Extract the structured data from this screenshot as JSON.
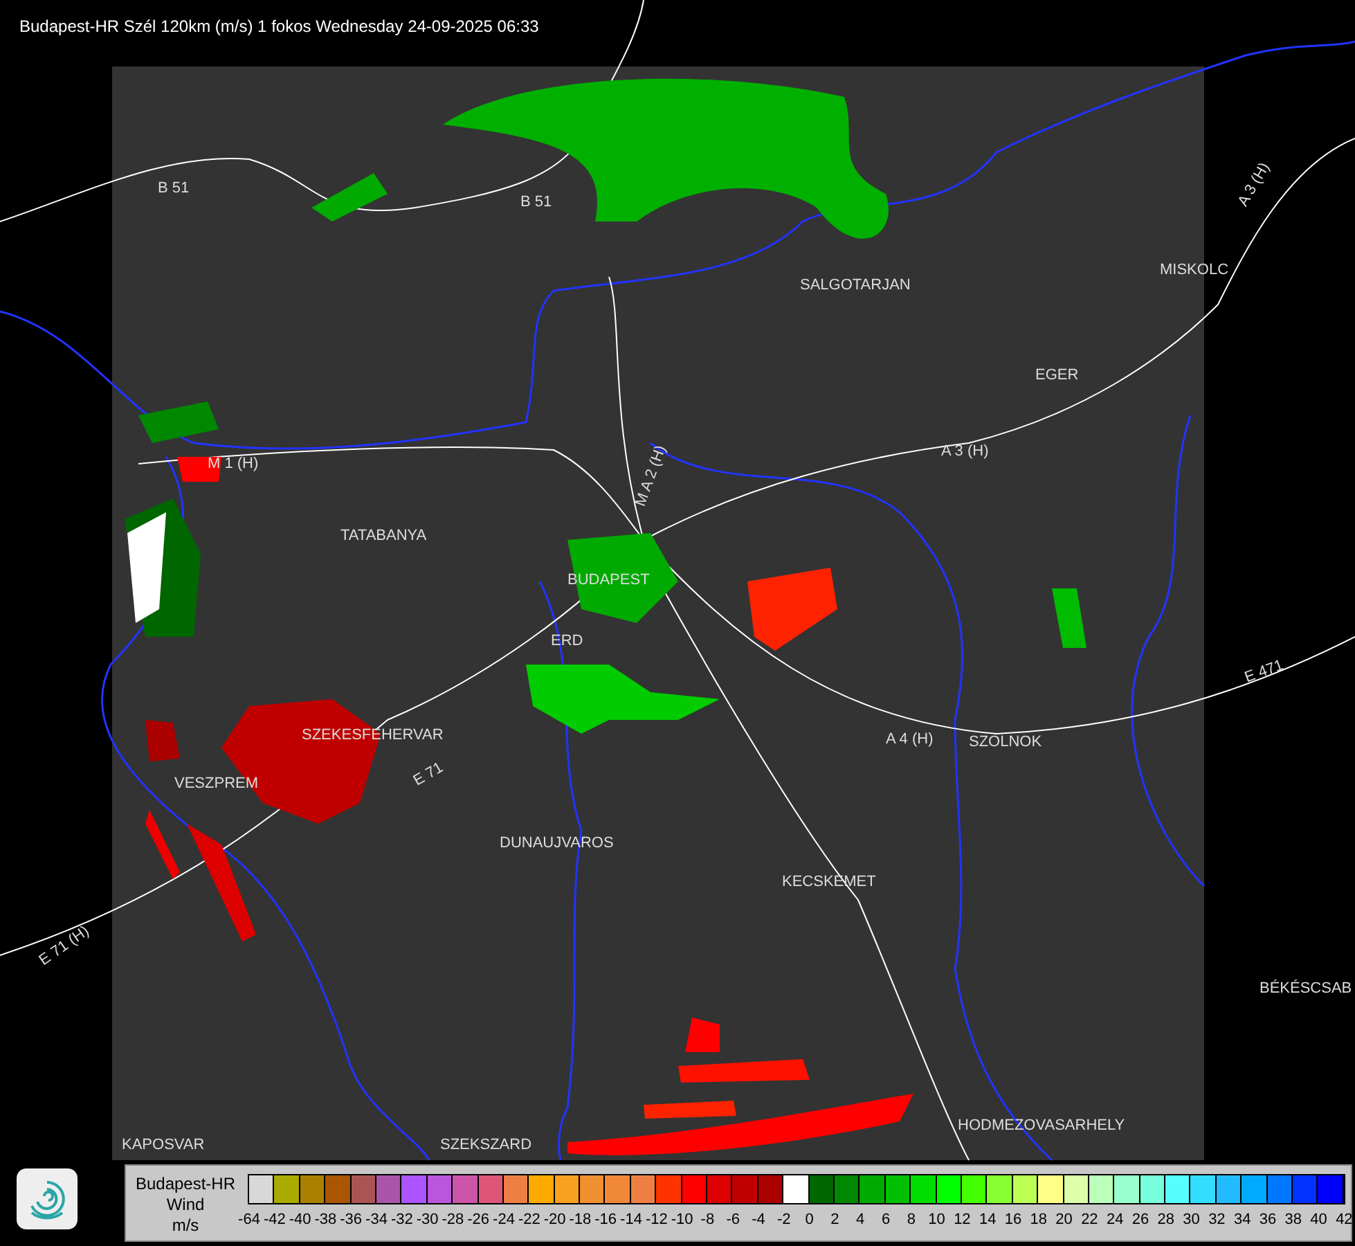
{
  "title": "Budapest-HR Szél 120km (m/s) 1 fokos Wednesday 24-09-2025 06:33",
  "map_labels": [
    {
      "text": "B 51"
    },
    {
      "text": "B 51"
    },
    {
      "text": "SALGOTARJAN"
    },
    {
      "text": "MISKOLC"
    },
    {
      "text": "A 3 (H)"
    },
    {
      "text": "EGER"
    },
    {
      "text": "M 1 (H)"
    },
    {
      "text": "A 3 (H)"
    },
    {
      "text": "M A 2 (H)"
    },
    {
      "text": "TATABANYA"
    },
    {
      "text": "BUDAPEST"
    },
    {
      "text": "ERD"
    },
    {
      "text": "E 471"
    },
    {
      "text": "SZEKESFEHERVAR"
    },
    {
      "text": "E 71"
    },
    {
      "text": "A 4 (H)"
    },
    {
      "text": "SZOLNOK"
    },
    {
      "text": "VESZPREM"
    },
    {
      "text": "DUNAUJVAROS"
    },
    {
      "text": "KECSKEMET"
    },
    {
      "text": "E 71 (H)"
    },
    {
      "text": "BÉKÉSCSAB"
    },
    {
      "text": "HODMEZOVASARHELY"
    },
    {
      "text": "KAPOSVAR"
    },
    {
      "text": "SZEKSZARD"
    }
  ],
  "legend": {
    "title": "Budapest-HR",
    "quantity": "Wind",
    "unit": "m/s",
    "swatches": [
      {
        "color": "#d8d8d8"
      },
      {
        "color": "#aaaa00"
      },
      {
        "color": "#aa8000"
      },
      {
        "color": "#aa5500"
      },
      {
        "color": "#aa5555"
      },
      {
        "color": "#aa55aa"
      },
      {
        "color": "#aa55ff"
      },
      {
        "color": "#bb55dd"
      },
      {
        "color": "#cc55aa"
      },
      {
        "color": "#dd5577"
      },
      {
        "color": "#ee7f44"
      },
      {
        "color": "#ffaa00"
      },
      {
        "color": "#f8a020"
      },
      {
        "color": "#f09030"
      },
      {
        "color": "#f08838"
      },
      {
        "color": "#ee7f44"
      },
      {
        "color": "#ff3300"
      },
      {
        "color": "#ff0000"
      },
      {
        "color": "#dd0000"
      },
      {
        "color": "#c00000"
      },
      {
        "color": "#aa0000"
      },
      {
        "color": "#ffffff"
      },
      {
        "color": "#006600"
      },
      {
        "color": "#008800"
      },
      {
        "color": "#00aa00"
      },
      {
        "color": "#00c000"
      },
      {
        "color": "#00dd00"
      },
      {
        "color": "#00ff00"
      },
      {
        "color": "#44ff00"
      },
      {
        "color": "#88ff33"
      },
      {
        "color": "#bbff55"
      },
      {
        "color": "#ffff88"
      },
      {
        "color": "#ddffaa"
      },
      {
        "color": "#bbffbb"
      },
      {
        "color": "#99ffcc"
      },
      {
        "color": "#77ffdd"
      },
      {
        "color": "#55ffff"
      },
      {
        "color": "#33ddff"
      },
      {
        "color": "#22bbff"
      },
      {
        "color": "#00aaff"
      },
      {
        "color": "#0077ff"
      },
      {
        "color": "#0033ff"
      },
      {
        "color": "#0000ff"
      }
    ],
    "ticks": [
      "-64",
      "-42",
      "-40",
      "-38",
      "-36",
      "-34",
      "-32",
      "-30",
      "-28",
      "-26",
      "-24",
      "-22",
      "-20",
      "-18",
      "-16",
      "-14",
      "-12",
      "-10",
      "-8",
      "-6",
      "-4",
      "-2",
      "0",
      "2",
      "4",
      "6",
      "8",
      "10",
      "12",
      "14",
      "16",
      "18",
      "20",
      "22",
      "24",
      "26",
      "28",
      "30",
      "32",
      "34",
      "36",
      "38",
      "40",
      "42"
    ]
  }
}
